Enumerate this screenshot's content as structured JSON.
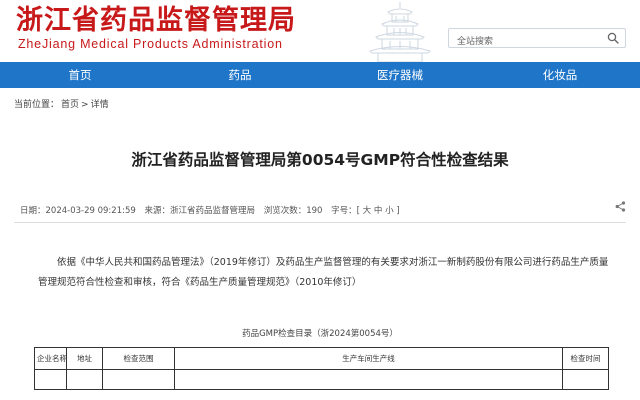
{
  "header": {
    "title": "浙江省药品监督管理局",
    "subtitle": "ZheJiang Medical Products Administration",
    "search_placeholder": "全站搜索",
    "search_icon": "search-icon"
  },
  "nav": {
    "items": [
      {
        "label": "首页"
      },
      {
        "label": "药品"
      },
      {
        "label": "医疗器械"
      },
      {
        "label": "化妆品"
      }
    ]
  },
  "breadcrumb": {
    "prefix": "当前位置：",
    "home": "首页",
    "sep": ">",
    "current": "详情"
  },
  "article": {
    "title": "浙江省药品监督管理局第0054号GMP符合性检查结果",
    "date": "日期：2024-03-29 09:21:59",
    "source": "来源：浙江省药品监督管理局",
    "views": "浏览次数：190",
    "font_size": "字号：[ 大 中 小 ]",
    "share_icon": "share-icon",
    "body": "依据《中华人民共和国药品管理法》（2019年修订）及药品生产监督管理的有关要求对浙江一新制药股份有限公司进行药品生产质量管理规范符合性检查和审核，符合《药品生产质量管理规范》（2010年修订）",
    "table_caption": "药品GMP检查目录（浙2024第0054号）",
    "table_headers": [
      "企业名称",
      "地址",
      "检查范围",
      "生产车间生产线",
      "检查时间"
    ]
  },
  "colors": {
    "brand_red": "#c8191a",
    "nav_blue": "#1f76c8"
  }
}
